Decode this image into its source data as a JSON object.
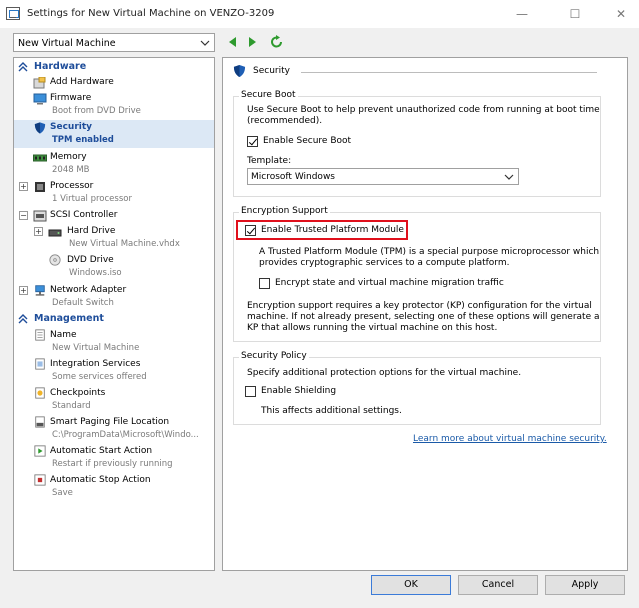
{
  "window": {
    "title": "Settings for New Virtual Machine on VENZO-3209",
    "minimize": "—",
    "maximize": "☐",
    "close": "✕"
  },
  "toolbar": {
    "vm_selected": "New Virtual Machine"
  },
  "left": {
    "hardware_header": "Hardware",
    "management_header": "Management",
    "hardware_items": [
      {
        "label": "Add Hardware",
        "sub": ""
      },
      {
        "label": "Firmware",
        "sub": "Boot from DVD Drive"
      },
      {
        "label": "Security",
        "sub": "TPM enabled"
      },
      {
        "label": "Memory",
        "sub": "2048 MB"
      },
      {
        "label": "Processor",
        "sub": "1 Virtual processor"
      },
      {
        "label": "SCSI Controller",
        "sub": ""
      },
      {
        "label": "Hard Drive",
        "sub": "New Virtual Machine.vhdx"
      },
      {
        "label": "DVD Drive",
        "sub": "Windows.iso"
      },
      {
        "label": "Network Adapter",
        "sub": "Default Switch"
      }
    ],
    "management_items": [
      {
        "label": "Name",
        "sub": "New Virtual Machine"
      },
      {
        "label": "Integration Services",
        "sub": "Some services offered"
      },
      {
        "label": "Checkpoints",
        "sub": "Standard"
      },
      {
        "label": "Smart Paging File Location",
        "sub": "C:\\ProgramData\\Microsoft\\Windo..."
      },
      {
        "label": "Automatic Start Action",
        "sub": "Restart if previously running"
      },
      {
        "label": "Automatic Stop Action",
        "sub": "Save"
      }
    ]
  },
  "right": {
    "section_title": "Security",
    "secure_boot": {
      "group": "Secure Boot",
      "description": "Use Secure Boot to help prevent unauthorized code from running at boot time (recommended).",
      "description_line1": "Use Secure Boot to help prevent unauthorized code from running at boot time",
      "description_line2": "(recommended).",
      "enable_label": "Enable Secure Boot",
      "enable_checked": true,
      "template_label": "Template:",
      "template_value": "Microsoft Windows"
    },
    "encryption": {
      "group": "Encryption Support",
      "tpm_label": "Enable Trusted Platform Module",
      "tpm_checked": true,
      "tpm_desc_line1": "A Trusted Platform Module (TPM) is a special purpose microprocessor which",
      "tpm_desc_line2": "provides cryptographic services to a compute platform.",
      "migration_label": "Encrypt state and virtual machine migration traffic",
      "migration_checked": false,
      "kp_line1": "Encryption support requires a key protector (KP) configuration for the virtual",
      "kp_line2": "machine. If not already present, selecting one of these options will generate a",
      "kp_line3": "KP that allows running the virtual machine on this host.",
      "highlight_color": "#e0101c"
    },
    "policy": {
      "group": "Security Policy",
      "description": "Specify additional protection options for the virtual machine.",
      "shielding_label": "Enable Shielding",
      "shielding_checked": false,
      "note": "This affects additional settings."
    },
    "learn_more": "Learn more about virtual machine security."
  },
  "buttons": {
    "ok": "OK",
    "cancel": "Cancel",
    "apply": "Apply"
  },
  "colors": {
    "accent": "#1e4d9a",
    "link": "#1a5aa8",
    "selection": "#dce8f5"
  }
}
